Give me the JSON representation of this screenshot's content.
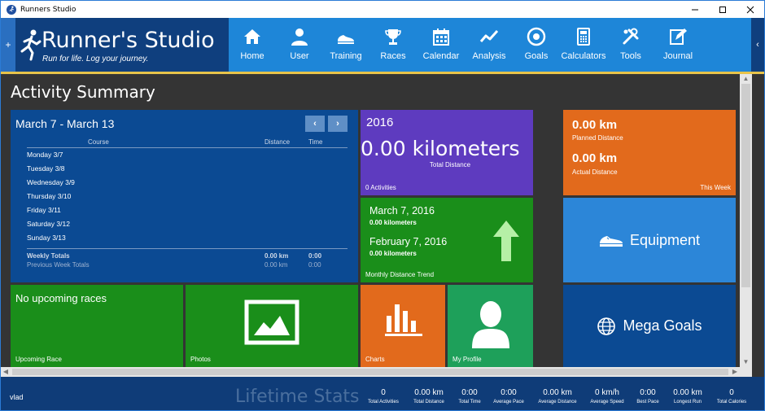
{
  "window": {
    "title": "Runners Studio"
  },
  "header": {
    "title": "Runner's Studio",
    "tagline": "Run for life. Log your journey.",
    "nav": [
      {
        "label": "Home",
        "icon": "home-icon"
      },
      {
        "label": "User",
        "icon": "user-icon"
      },
      {
        "label": "Training",
        "icon": "shoe-icon"
      },
      {
        "label": "Races",
        "icon": "trophy-icon"
      },
      {
        "label": "Calendar",
        "icon": "calendar-icon"
      },
      {
        "label": "Analysis",
        "icon": "trend-line-icon"
      },
      {
        "label": "Goals",
        "icon": "target-icon"
      },
      {
        "label": "Calculators",
        "icon": "calculator-icon"
      },
      {
        "label": "Tools",
        "icon": "tools-icon"
      },
      {
        "label": "Journal",
        "icon": "journal-icon"
      }
    ]
  },
  "page": {
    "title": "Activity Summary"
  },
  "week": {
    "range": "March 7 - March 13",
    "columns": {
      "course": "Course",
      "distance": "Distance",
      "time": "Time"
    },
    "days": [
      "Monday 3/7",
      "Tuesday 3/8",
      "Wednesday 3/9",
      "Thursday 3/10",
      "Friday 3/11",
      "Saturday 3/12",
      "Sunday 3/13"
    ],
    "weekly_totals": {
      "label": "Weekly Totals",
      "distance": "0.00 km",
      "time": "0:00"
    },
    "previous_totals": {
      "label": "Previous Week Totals",
      "distance": "0.00 km",
      "time": "0:00"
    }
  },
  "year_tile": {
    "year": "2016",
    "value": "0.00 kilometers",
    "label": "Total Distance",
    "caption": "0 Activities"
  },
  "this_week_tile": {
    "planned_value": "0.00 km",
    "planned_label": "Planned Distance",
    "actual_value": "0.00 km",
    "actual_label": "Actual Distance",
    "caption": "This Week"
  },
  "trend_tile": {
    "date1": "March 7, 2016",
    "value1": "0.00 kilometers",
    "date2": "February 7, 2016",
    "value2": "0.00 kilometers",
    "caption": "Monthly Distance Trend"
  },
  "equipment_tile": {
    "label": "Equipment"
  },
  "races_tile": {
    "message": "No upcoming races",
    "caption": "Upcoming Race"
  },
  "photos_tile": {
    "caption": "Photos"
  },
  "charts_tile": {
    "caption": "Charts"
  },
  "profile_tile": {
    "caption": "My Profile"
  },
  "mega_goals_tile": {
    "label": "Mega Goals"
  },
  "footer": {
    "user": "vlad",
    "lifetime_title": "Lifetime Stats",
    "stats": [
      {
        "value": "0",
        "label": "Total Activities"
      },
      {
        "value": "0.00 km",
        "label": "Total Distance"
      },
      {
        "value": "0:00",
        "label": "Total Time"
      },
      {
        "value": "0:00",
        "label": "Average Pace"
      },
      {
        "value": "0.00 km",
        "label": "Average Distance"
      },
      {
        "value": "0 km/h",
        "label": "Average Speed"
      },
      {
        "value": "0:00",
        "label": "Best Pace"
      },
      {
        "value": "0.00 km",
        "label": "Longest Run"
      },
      {
        "value": "0",
        "label": "Total Calories"
      }
    ]
  },
  "colors": {
    "header_blue": "#1e86d8",
    "logo_navy": "#0f3f7e",
    "tile_green": "#1a8e1a",
    "tile_orange": "#e26a1c",
    "tile_purple": "#5e3bbf",
    "tile_blue": "#2c86d8",
    "tile_navy": "#0b4a93"
  }
}
